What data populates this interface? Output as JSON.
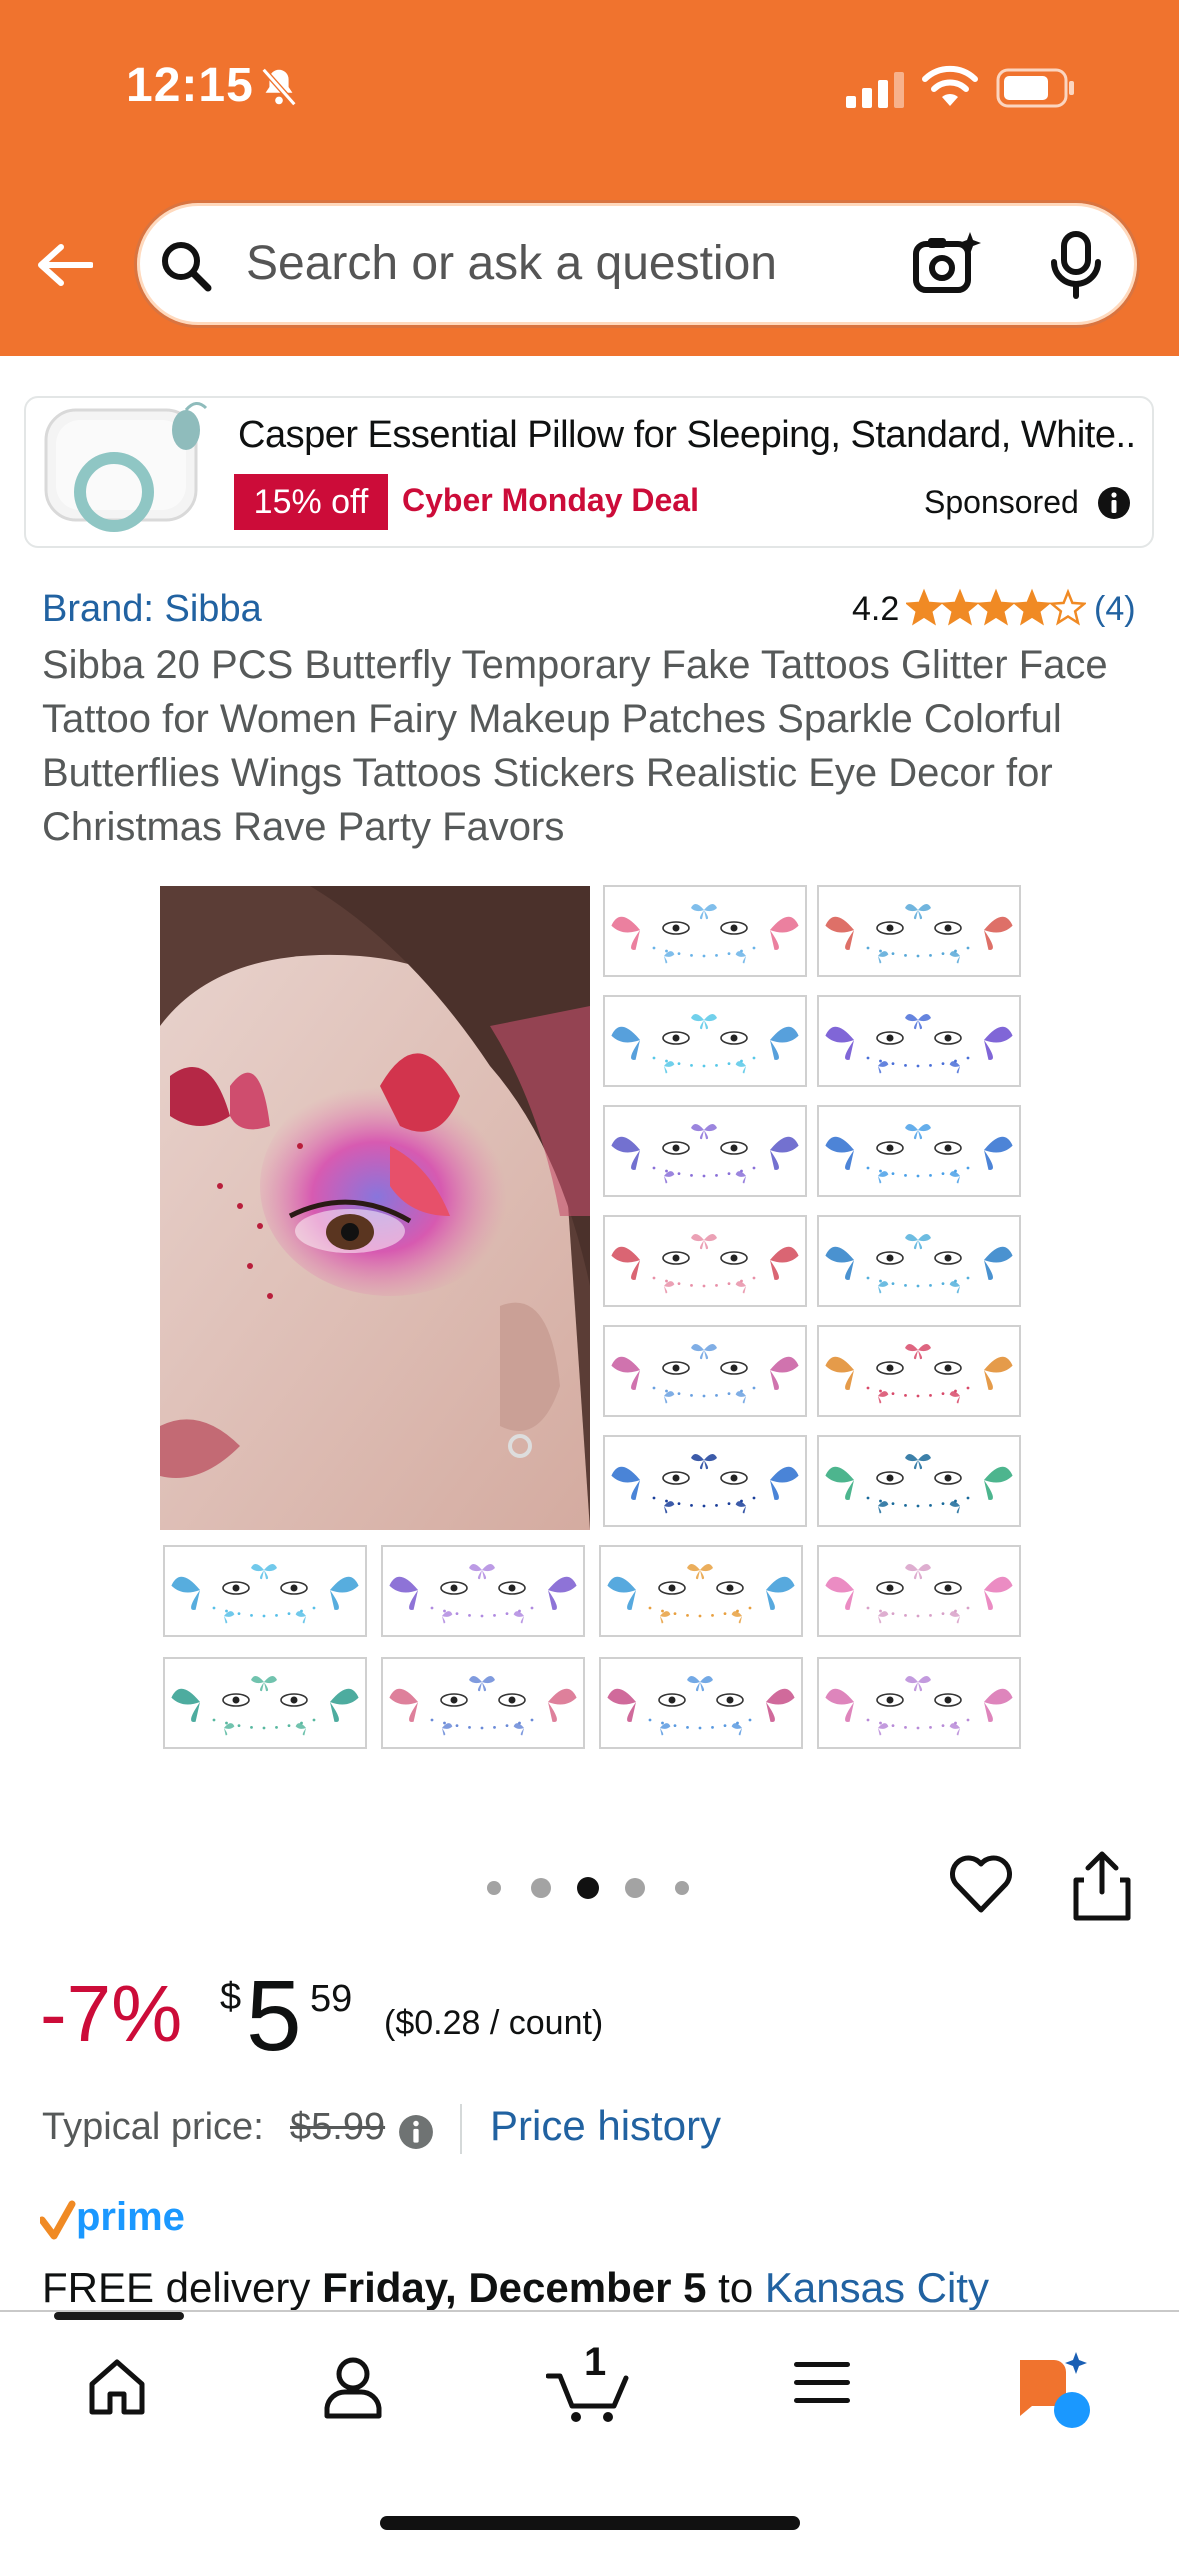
{
  "status_bar": {
    "time": "12:15"
  },
  "search": {
    "placeholder": "Search or ask a question"
  },
  "ad": {
    "title": "Casper Essential Pillow for Sleeping, Standard, White...",
    "badge": "15% off",
    "deal": "Cyber Monday Deal",
    "sponsored": "Sponsored"
  },
  "product": {
    "brand": "Brand: Sibba",
    "rating": "4.2",
    "rating_stars": 4.2,
    "rating_count": "(4)",
    "title": "Sibba 20 PCS Butterfly Temporary Fake Tattoos Glitter Face Tattoo for Women Fairy Makeup Patches Sparkle Colorful Butterflies Wings Tattoos Stickers Realistic Eye Decor for Christmas Rave Party Favors"
  },
  "gallery": {
    "dot_count": 5,
    "active_dot": 3
  },
  "price": {
    "discount": "-7%",
    "symbol": "$",
    "whole": "5",
    "fraction": "59",
    "unit": "($0.28 / count)",
    "typical_label": "Typical price:",
    "typical_value": "$5.99",
    "history_link": "Price history"
  },
  "delivery": {
    "prefix": "FREE delivery",
    "date": "Friday, December 5",
    "to": "to",
    "city": "Kansas City"
  },
  "nav": {
    "cart_count": "1",
    "items": [
      "home-icon",
      "account-icon",
      "cart-icon",
      "menu-icon",
      "rufus-icon"
    ]
  },
  "colors": {
    "header": "#f0732e",
    "deal_red": "#cc0c39",
    "link_blue": "#2162a1",
    "star": "#f08a24"
  }
}
